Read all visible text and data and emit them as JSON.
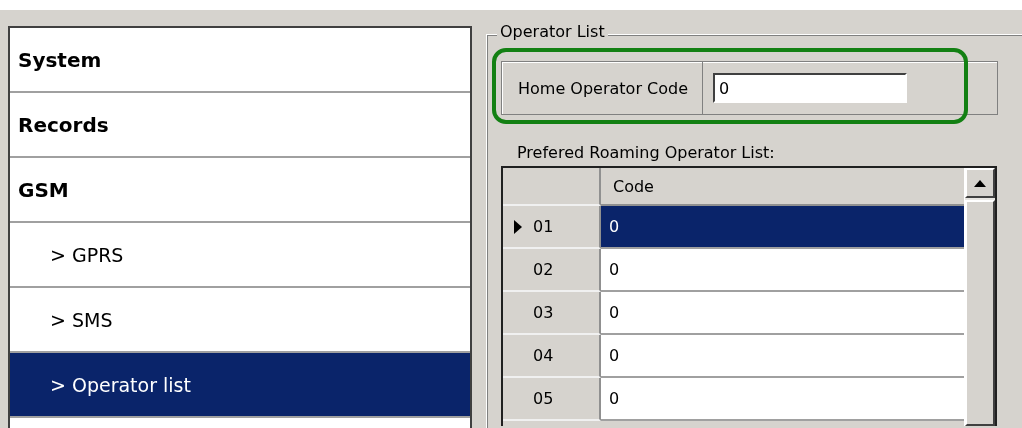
{
  "sidebar": {
    "items": [
      {
        "label": "System",
        "kind": "section",
        "selected": false
      },
      {
        "label": "Records",
        "kind": "section",
        "selected": false
      },
      {
        "label": "GSM",
        "kind": "section",
        "selected": false
      },
      {
        "label": "> GPRS",
        "kind": "sub",
        "selected": false
      },
      {
        "label": "> SMS",
        "kind": "sub",
        "selected": false
      },
      {
        "label": "> Operator list",
        "kind": "sub",
        "selected": true
      }
    ]
  },
  "group": {
    "title": "Operator List",
    "home_operator": {
      "label": "Home Operator Code",
      "value": "0"
    },
    "roaming_label": "Prefered Roaming Operator List:",
    "table": {
      "columns": [
        "Code"
      ],
      "rows": [
        {
          "number": "01",
          "code": "0",
          "selected": true
        },
        {
          "number": "02",
          "code": "0",
          "selected": false
        },
        {
          "number": "03",
          "code": "0",
          "selected": false
        },
        {
          "number": "04",
          "code": "0",
          "selected": false
        },
        {
          "number": "05",
          "code": "0",
          "selected": false
        }
      ]
    }
  }
}
